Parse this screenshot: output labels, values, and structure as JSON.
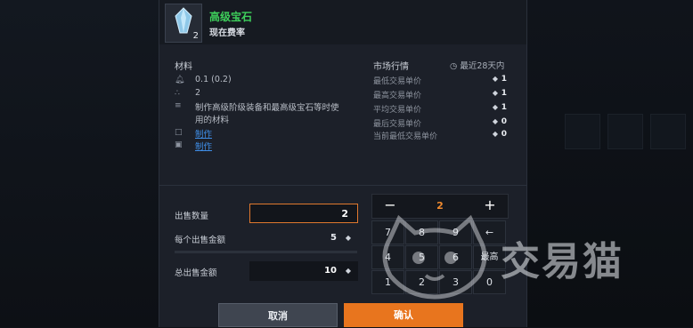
{
  "item": {
    "name": "高级宝石",
    "subtitle": "现在费率",
    "count": "2"
  },
  "materials": {
    "title": "材料",
    "weight": "0.1 (0.2)",
    "stack": "2",
    "description_line1": "制作高级阶级装备和最高级宝石等时使",
    "description_line2": "用的材料",
    "link1": "制作",
    "link2": "制作"
  },
  "market": {
    "title": "市场行情",
    "period": "最近28天内",
    "rows": [
      {
        "label": "最低交易单价",
        "value": "1"
      },
      {
        "label": "最高交易单价",
        "value": "1"
      },
      {
        "label": "平均交易单价",
        "value": "1"
      },
      {
        "label": "最后交易单价",
        "value": "0"
      },
      {
        "label": "当前最低交易单价",
        "value": "0"
      }
    ]
  },
  "sell": {
    "quantity_label": "出售数量",
    "quantity_value": "2",
    "unit_label": "每个出售金额",
    "unit_value": "5",
    "total_label": "总出售金额",
    "total_value": "10"
  },
  "stepper": {
    "minus": "−",
    "value": "2",
    "plus": "+"
  },
  "keypad": {
    "keys": [
      "7",
      "8",
      "9",
      "←",
      "4",
      "5",
      "6",
      "最高",
      "1",
      "2",
      "3",
      "0"
    ]
  },
  "buttons": {
    "cancel": "取消",
    "confirm": "确认"
  },
  "watermark": {
    "text": "交易猫"
  },
  "colors": {
    "item_name": "#3ecf5b",
    "accent": "#e8751e",
    "link": "#3f8ee8",
    "panel_bg": "#1c2029"
  }
}
